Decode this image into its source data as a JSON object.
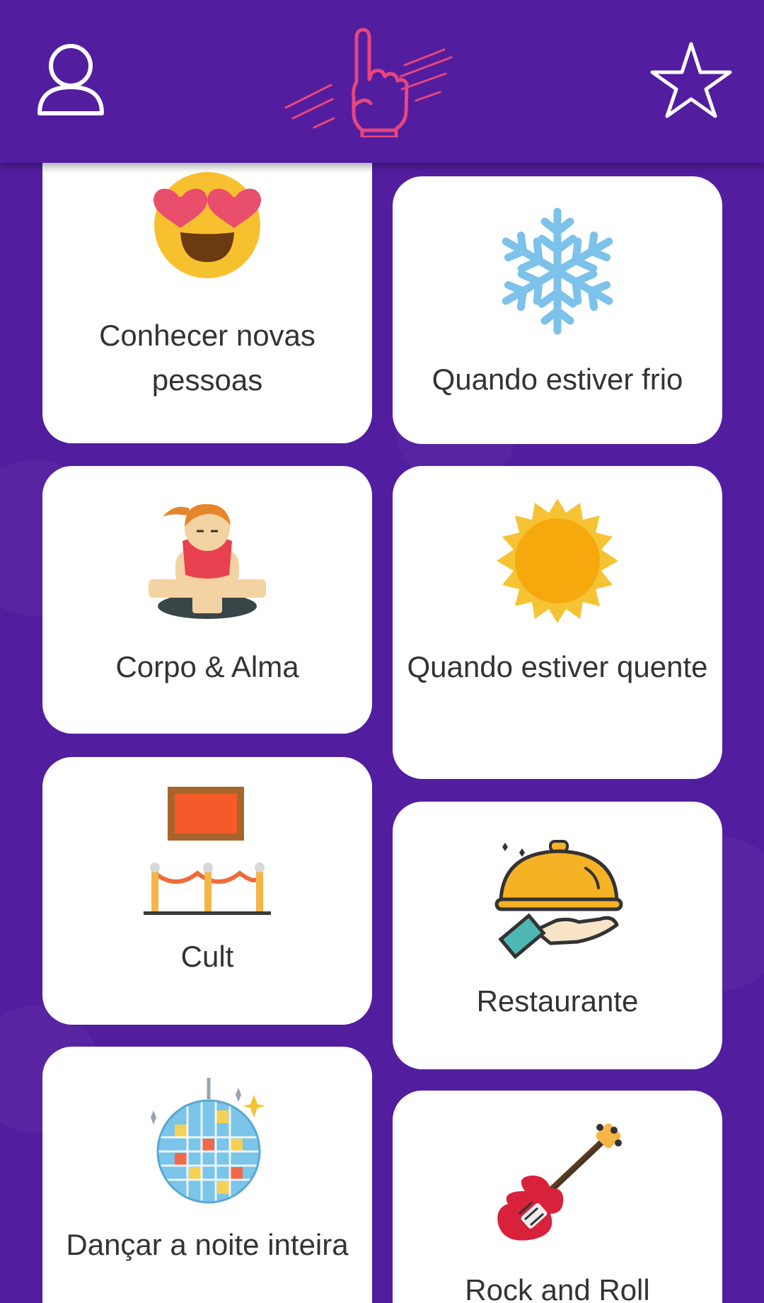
{
  "header": {
    "profile_icon": "person-outline-icon",
    "logo_icon": "hand-pointing-logo-icon",
    "favorites_icon": "star-outline-icon"
  },
  "colors": {
    "background": "#521d9f",
    "card": "#ffffff",
    "text": "#333333",
    "logo": "#e8457d"
  },
  "categories": [
    {
      "label": "Conhecer novas pessoas",
      "icon": "heart-eyes-emoji-icon"
    },
    {
      "label": "Quando estiver frio",
      "icon": "snowflake-icon"
    },
    {
      "label": "Corpo & Alma",
      "icon": "meditation-icon"
    },
    {
      "label": "Quando estiver quente",
      "icon": "sun-icon"
    },
    {
      "label": "Cult",
      "icon": "museum-painting-icon"
    },
    {
      "label": "Restaurante",
      "icon": "serving-cloche-icon"
    },
    {
      "label": "Dançar a noite inteira",
      "icon": "disco-ball-icon"
    },
    {
      "label": "Rock and Roll",
      "icon": "electric-guitar-icon"
    }
  ]
}
